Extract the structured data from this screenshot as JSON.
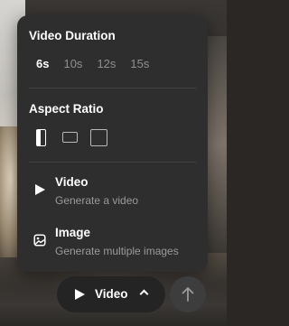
{
  "popup": {
    "duration": {
      "title": "Video Duration",
      "options": [
        "6s",
        "10s",
        "12s",
        "15s"
      ],
      "selected": "6s"
    },
    "aspect_ratio": {
      "title": "Aspect Ratio",
      "options": [
        "portrait-icon",
        "landscape-icon",
        "square-icon"
      ],
      "selected": "portrait-icon"
    },
    "modes": [
      {
        "label": "Video",
        "description": "Generate a video",
        "icon": "play-icon"
      },
      {
        "label": "Image",
        "description": "Generate multiple images",
        "icon": "image-icon"
      }
    ]
  },
  "toolbar": {
    "mode_label": "Video",
    "mode_icon": "play-icon",
    "expand_icon": "chevron-up-icon",
    "submit_icon": "arrow-up-icon"
  },
  "colors": {
    "popup_bg": "#2e2e2e",
    "selected_text": "#ffffff",
    "muted_text": "#8f8f8f",
    "send_button_bg": "#3d3d3d"
  }
}
